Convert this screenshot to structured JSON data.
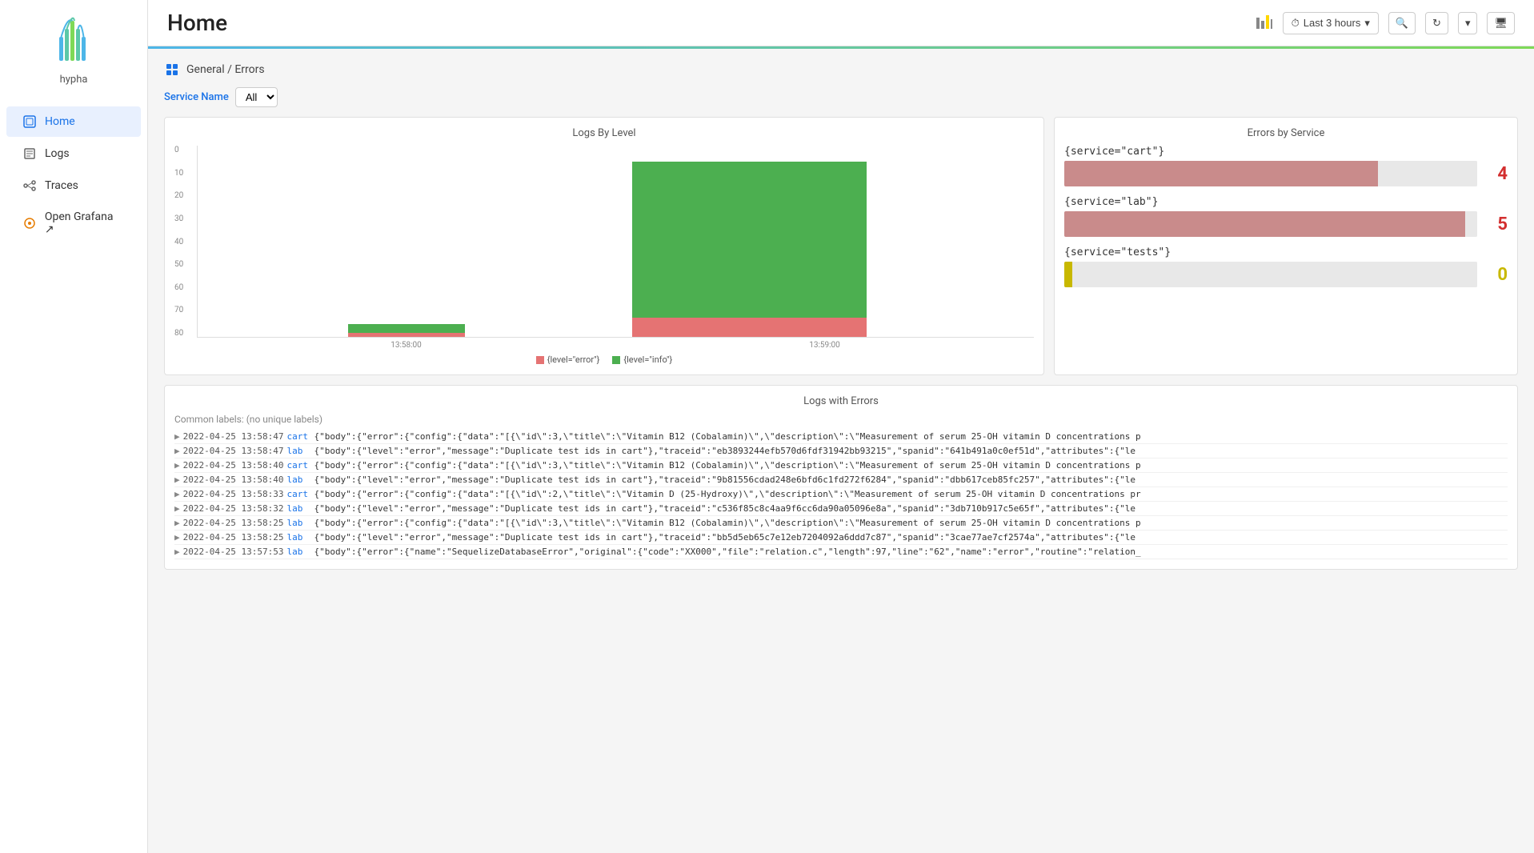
{
  "sidebar": {
    "logo_label": "hypha",
    "items": [
      {
        "id": "home",
        "label": "Home",
        "icon": "home-icon",
        "active": true
      },
      {
        "id": "logs",
        "label": "Logs",
        "icon": "logs-icon",
        "active": false
      },
      {
        "id": "traces",
        "label": "Traces",
        "icon": "traces-icon",
        "active": false
      },
      {
        "id": "open-grafana",
        "label": "Open Grafana ↗",
        "icon": "grafana-icon",
        "active": false
      }
    ]
  },
  "header": {
    "title": "Home",
    "toolbar": {
      "chart_icon_label": "chart",
      "time_range": "Last 3 hours",
      "zoom_icon_label": "zoom",
      "refresh_icon_label": "refresh",
      "chevron_icon_label": "chevron",
      "monitor_icon_label": "monitor"
    }
  },
  "breadcrumb": {
    "icon_label": "grid-icon",
    "text": "General / Errors"
  },
  "filter": {
    "label": "Service Name",
    "options": [
      "All"
    ],
    "selected": "All"
  },
  "logs_by_level": {
    "title": "Logs By Level",
    "y_ticks": [
      0,
      10,
      20,
      30,
      40,
      50,
      60,
      70,
      80
    ],
    "bars": [
      {
        "x": "13:58:00",
        "error": 2,
        "info": 4
      },
      {
        "x": "13:59:00",
        "error": 9,
        "info": 72
      }
    ],
    "x_labels": [
      "13:58:00",
      "13:59:00"
    ],
    "legend": [
      {
        "label": "{level=\"error\"}",
        "color": "#e57373"
      },
      {
        "label": "{level=\"info\"}",
        "color": "#4caf50"
      }
    ],
    "colors": {
      "error": "#e57373",
      "info": "#4caf50"
    }
  },
  "errors_by_service": {
    "title": "Errors by Service",
    "services": [
      {
        "label": "{service=\"cart\"}",
        "count": 4,
        "count_color": "#d32f2f",
        "bar_fill_pct": 76,
        "bar_fill_color": "#c98b8b",
        "bar_empty_color": "#e0e0e0"
      },
      {
        "label": "{service=\"lab\"}",
        "count": 5,
        "count_color": "#d32f2f",
        "bar_fill_pct": 97,
        "bar_fill_color": "#c98b8b",
        "bar_empty_color": "#e0e0e0"
      },
      {
        "label": "{service=\"tests\"}",
        "count": 0,
        "count_color": "#c8b800",
        "bar_fill_pct": 2,
        "bar_fill_color": "#c8b800",
        "bar_empty_color": "#e0e0e0"
      }
    ]
  },
  "logs_with_errors": {
    "title": "Logs with Errors",
    "common_labels_label": "Common labels:",
    "common_labels_value": "(no unique labels)",
    "entries": [
      {
        "timestamp": "2022-04-25 13:58:47",
        "service": "cart",
        "body": "{\"body\":{\"error\":{\"config\":{\"data\":\"[{\\\"id\\\":3,\\\"title\\\":\\\"Vitamin B12 (Cobalamin)\\\",\\\"description\\\":\\\"Measurement of serum 25-OH vitamin D concentrations p"
      },
      {
        "timestamp": "2022-04-25 13:58:47",
        "service": "lab",
        "body": "{\"body\":{\"level\":\"error\",\"message\":\"Duplicate test ids in cart\"},\"traceid\":\"eb3893244efb570d6fdf31942bb93215\",\"spanid\":\"641b491a0c0ef51d\",\"attributes\":{\"le"
      },
      {
        "timestamp": "2022-04-25 13:58:40",
        "service": "cart",
        "body": "{\"body\":{\"error\":{\"config\":{\"data\":\"[{\\\"id\\\":3,\\\"title\\\":\\\"Vitamin B12 (Cobalamin)\\\",\\\"description\\\":\\\"Measurement of serum 25-OH vitamin D concentrations p"
      },
      {
        "timestamp": "2022-04-25 13:58:40",
        "service": "lab",
        "body": "{\"body\":{\"level\":\"error\",\"message\":\"Duplicate test ids in cart\"},\"traceid\":\"9b81556cdad248e6bfd6c1fd272f6284\",\"spanid\":\"dbb617ceb85fc257\",\"attributes\":{\"le"
      },
      {
        "timestamp": "2022-04-25 13:58:33",
        "service": "cart",
        "body": "{\"body\":{\"error\":{\"config\":{\"data\":\"[{\\\"id\\\":2,\\\"title\\\":\\\"Vitamin D (25-Hydroxy)\\\",\\\"description\\\":\\\"Measurement of serum 25-OH vitamin D concentrations pr"
      },
      {
        "timestamp": "2022-04-25 13:58:32",
        "service": "lab",
        "body": "{\"body\":{\"level\":\"error\",\"message\":\"Duplicate test ids in cart\"},\"traceid\":\"c536f85c8c4aa9f6cc6da90a05096e8a\",\"spanid\":\"3db710b917c5e65f\",\"attributes\":{\"le"
      },
      {
        "timestamp": "2022-04-25 13:58:25",
        "service": "lab",
        "body": "{\"body\":{\"error\":{\"config\":{\"data\":\"[{\\\"id\\\":3,\\\"title\\\":\\\"Vitamin B12 (Cobalamin)\\\",\\\"description\\\":\\\"Measurement of serum 25-OH vitamin D concentrations p"
      },
      {
        "timestamp": "2022-04-25 13:58:25",
        "service": "lab",
        "body": "{\"body\":{\"level\":\"error\",\"message\":\"Duplicate test ids in cart\"},\"traceid\":\"bb5d5eb65c7e12eb7204092a6ddd7c87\",\"spanid\":\"3cae77ae7cf2574a\",\"attributes\":{\"le"
      },
      {
        "timestamp": "2022-04-25 13:57:53",
        "service": "lab",
        "body": "{\"body\":{\"error\":{\"name\":\"SequelizeDatabaseError\",\"original\":{\"code\":\"XX000\",\"file\":\"relation.c\",\"length\":97,\"line\":\"62\",\"name\":\"error\",\"routine\":\"relation_"
      }
    ]
  }
}
